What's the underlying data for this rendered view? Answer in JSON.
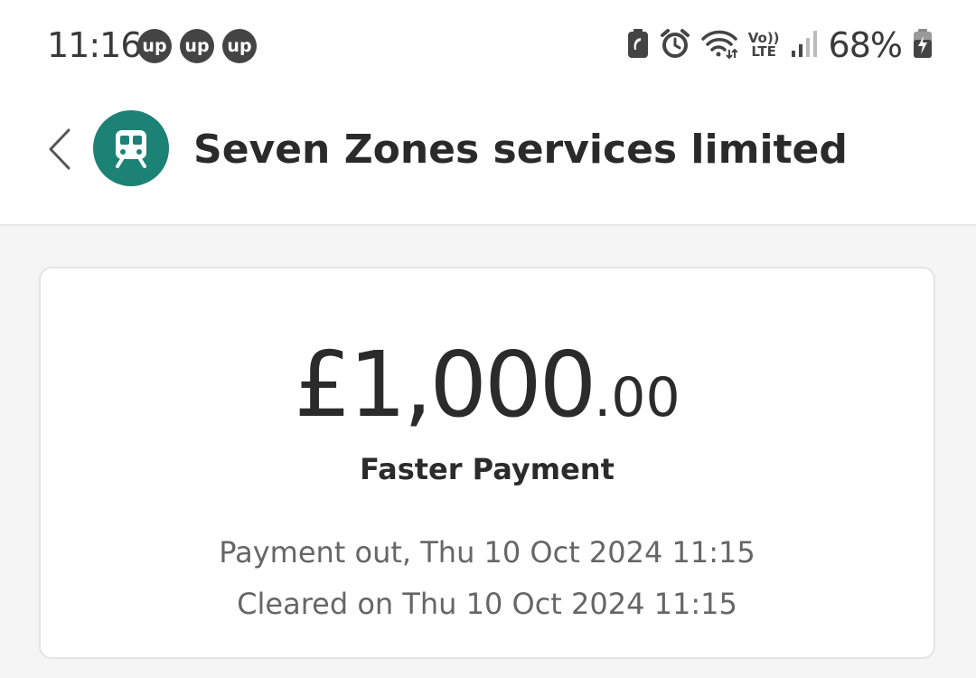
{
  "status_bar": {
    "time": "11:16",
    "badges": [
      "up",
      "up",
      "up"
    ],
    "volte_label_top": "Vo))",
    "volte_label_bottom": "LTE",
    "battery_percent": "68%",
    "icons": [
      "battery-saver-icon",
      "alarm-icon",
      "wifi-icon",
      "volte-icon",
      "signal-icon",
      "battery-icon"
    ]
  },
  "header": {
    "merchant_name": "Seven Zones services limited",
    "avatar_icon": "train-icon",
    "avatar_color": "#1c8275"
  },
  "transaction": {
    "amount_major": "£1,000",
    "amount_minor": ".00",
    "type": "Faster Payment",
    "payment_out": "Payment out, Thu 10 Oct 2024 11:15",
    "cleared": "Cleared on Thu 10 Oct 2024 11:15"
  }
}
